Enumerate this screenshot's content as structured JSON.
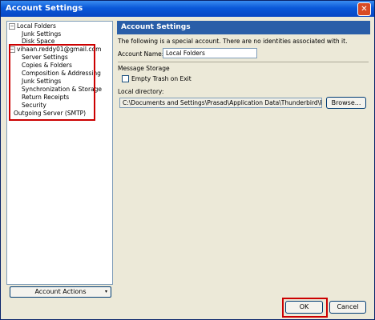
{
  "window": {
    "title": "Account Settings"
  },
  "tree": [
    {
      "label": "Local Folders",
      "expander": "⊟"
    },
    {
      "label": "Junk Settings"
    },
    {
      "label": "Disk Space"
    },
    {
      "label": "vihaan.reddy01@gmail.com",
      "expander": "⊟"
    },
    {
      "label": "Server Settings"
    },
    {
      "label": "Copies & Folders"
    },
    {
      "label": "Composition & Addressing"
    },
    {
      "label": "Junk Settings"
    },
    {
      "label": "Synchronization & Storage"
    },
    {
      "label": "Return Receipts"
    },
    {
      "label": "Security"
    },
    {
      "label": "Outgoing Server (SMTP)"
    }
  ],
  "account_actions": {
    "label": "Account Actions",
    "caret": "▾"
  },
  "panel": {
    "header": "Account Settings",
    "info": "The following is a special account. There are no identities associated with it.",
    "account_name_label": "Account Name:",
    "account_name_value": "Local Folders",
    "message_storage_label": "Message Storage",
    "empty_trash_label": "Empty Trash on Exit",
    "local_directory_label": "Local directory:",
    "local_directory_value": "C:\\Documents and Settings\\Prasad\\Application Data\\Thunderbird\\Profiles\\",
    "browse_label": "Browse..."
  },
  "footer": {
    "ok_label": "OK",
    "cancel_label": "Cancel"
  },
  "colors": {
    "highlight": "#cc0000",
    "header": "#2a5ea8",
    "titlebar": "#0a58d8"
  }
}
